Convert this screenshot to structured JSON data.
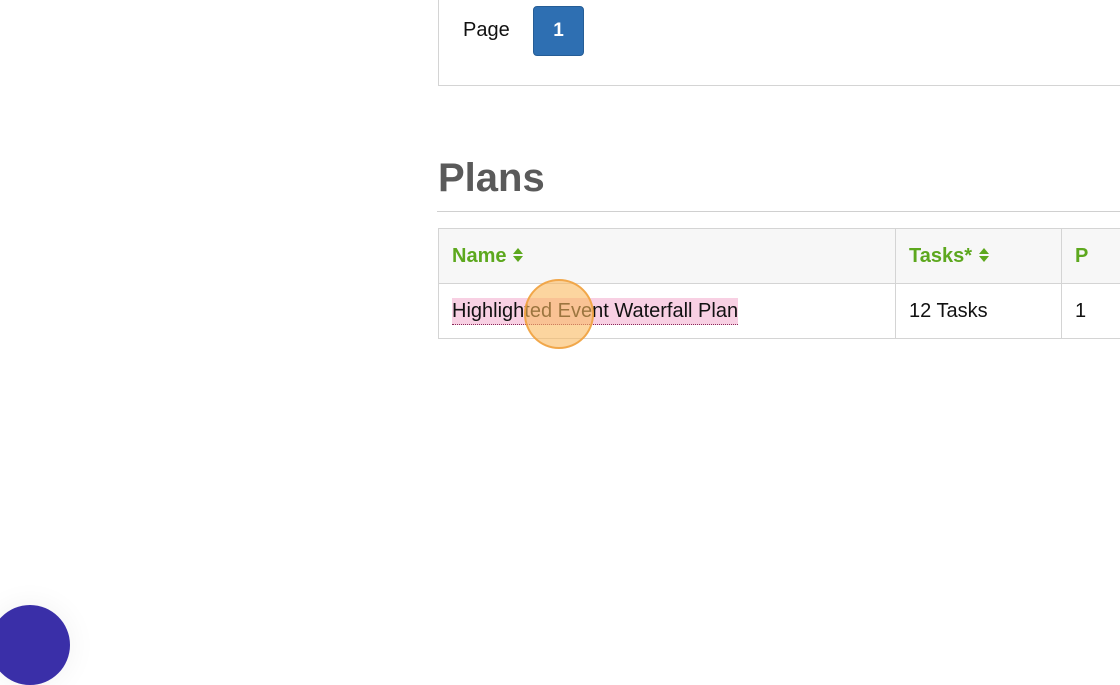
{
  "pagination": {
    "label": "Page",
    "current_page": "1"
  },
  "plans_section": {
    "title": "Plans",
    "columns": [
      {
        "label": "Name",
        "sortable": true
      },
      {
        "label": "Tasks*",
        "sortable": true
      },
      {
        "label": "P",
        "sortable": false
      }
    ],
    "rows": [
      {
        "name": "Highlighted Event Waterfall Plan",
        "tasks": "12 Tasks",
        "extra": "1"
      }
    ]
  },
  "colors": {
    "header_text": "#5da81e",
    "page_button": "#2e6fb2",
    "title_text": "#5a5a5a",
    "link_highlight": "#f8d0e3",
    "chat_bubble": "#3a2fa8"
  },
  "icons": {
    "sort": "sort-updown-icon",
    "chat": "chat-launcher-icon"
  }
}
